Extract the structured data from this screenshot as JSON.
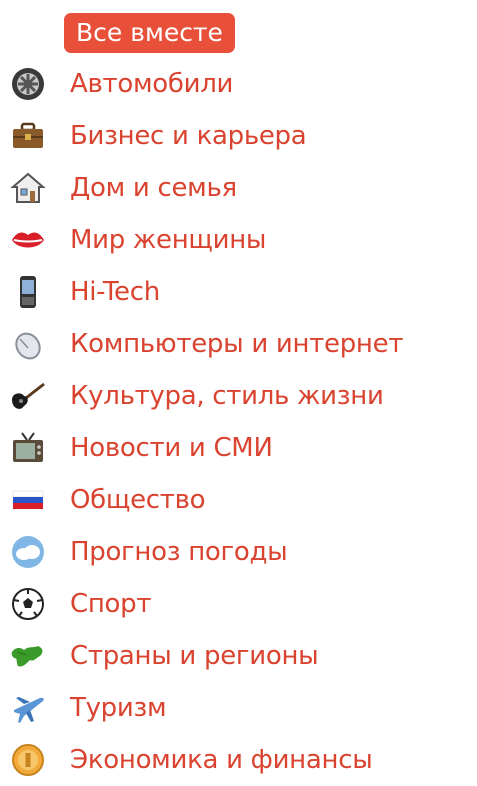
{
  "menu": {
    "all_label": "Все вместе",
    "accent_color": "#e8503a",
    "link_color": "#d9432f",
    "items": [
      {
        "label": "Автомобили",
        "icon": "car-wheel-icon"
      },
      {
        "label": "Бизнес и карьера",
        "icon": "briefcase-icon"
      },
      {
        "label": "Дом и семья",
        "icon": "house-icon"
      },
      {
        "label": "Мир женщины",
        "icon": "lips-icon"
      },
      {
        "label": "Hi-Tech",
        "icon": "mobile-phone-icon"
      },
      {
        "label": "Компьютеры и интернет",
        "icon": "computer-mouse-icon"
      },
      {
        "label": "Культура, стиль жизни",
        "icon": "guitar-icon"
      },
      {
        "label": "Новости и СМИ",
        "icon": "tv-icon"
      },
      {
        "label": "Общество",
        "icon": "russian-flag-icon"
      },
      {
        "label": "Прогноз погоды",
        "icon": "weather-cloud-icon"
      },
      {
        "label": "Спорт",
        "icon": "soccer-ball-icon"
      },
      {
        "label": "Страны и регионы",
        "icon": "world-map-icon"
      },
      {
        "label": "Туризм",
        "icon": "airplane-icon"
      },
      {
        "label": "Экономика и финансы",
        "icon": "coin-icon"
      }
    ]
  }
}
